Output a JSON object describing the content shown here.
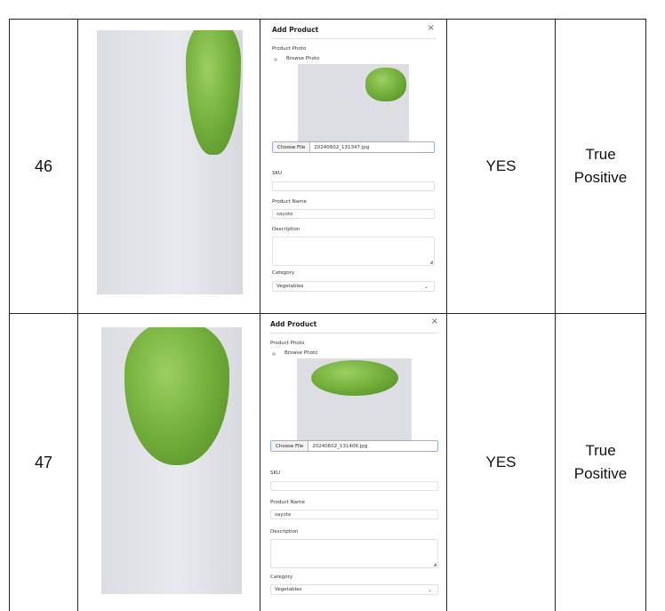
{
  "rows": [
    {
      "number": "46",
      "result": "YES",
      "outcome_line1": "True",
      "outcome_line2": "Positive",
      "form": {
        "title": "Add Product",
        "close_icon": "×",
        "photo_label": "Product Photo",
        "browse_label": "Browse Photo",
        "choose_file": "Choose File",
        "file_name": "20240602_131347.jpg",
        "sku_label": "SKU",
        "sku_value": "",
        "name_label": "Product Name",
        "name_value": "sayote",
        "description_label": "Description",
        "category_label": "Category",
        "category_value": "Vegetables"
      }
    },
    {
      "number": "47",
      "result": "YES",
      "outcome_line1": "True",
      "outcome_line2": "Positive",
      "form": {
        "title": "Add Product",
        "close_icon": "×",
        "photo_label": "Product Photo",
        "browse_label": "Browse Photo",
        "choose_file": "Choose File",
        "file_name": "20240602_131406.jpg",
        "sku_label": "SKU",
        "sku_value": "",
        "name_label": "Product Name",
        "name_value": "sayote",
        "description_label": "Description",
        "category_label": "Category",
        "category_value": "Vegetables"
      }
    }
  ],
  "colors": {
    "border": "#222222",
    "focus": "#8ab4f0",
    "vegetable": "#76b23d"
  },
  "icons": {
    "close": "close-icon",
    "dropdown": "chevron-down-icon",
    "resize": "resize-grip-icon"
  }
}
